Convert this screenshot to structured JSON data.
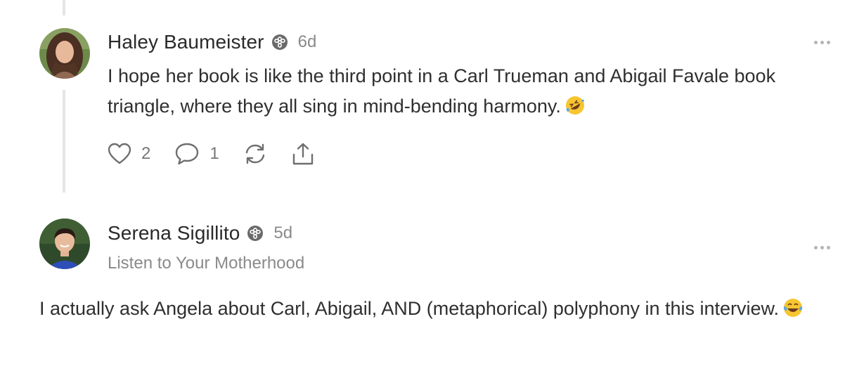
{
  "comments": [
    {
      "author": "Haley Baumeister",
      "badge_icon": "subscriber-badge-icon",
      "time": "6d",
      "body": "I hope her book is like the third point in a Carl Trueman and Abigail Favale book triangle, where they all sing in mind-bending harmony.",
      "emoji_icon": "rolling-on-floor-laughing-emoji",
      "actions": {
        "like_count": "2",
        "reply_count": "1"
      }
    },
    {
      "author": "Serena Sigillito",
      "badge_icon": "subscriber-badge-icon",
      "time": "5d",
      "publication": "Listen to Your Motherhood",
      "body": "I actually ask Angela about Carl, Abigail, AND (metaphorical) polyphony in this interview.",
      "emoji_icon": "face-with-tears-of-joy-emoji"
    }
  ],
  "colors": {
    "thread_line": "#e5e5e5",
    "muted_text": "#8a8a8a",
    "icon": "#6f6f6f"
  }
}
